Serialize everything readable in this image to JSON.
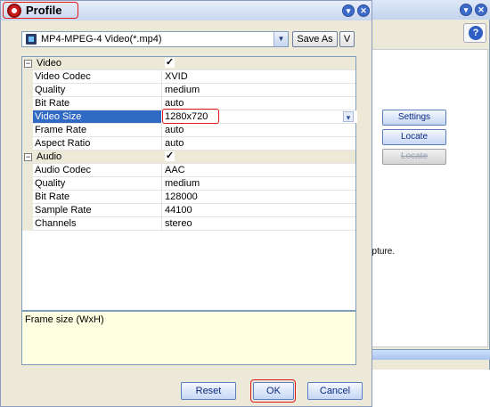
{
  "dialog": {
    "title": "Profile",
    "minimize_glyph": "▾",
    "close_glyph": "✕"
  },
  "format": {
    "selected": "MP4-MPEG-4 Video(*.mp4)",
    "dropdown_glyph": "▼",
    "icon": "film-icon",
    "save_as_label": "Save As",
    "v_label": "V"
  },
  "grid": {
    "video": {
      "category": "Video",
      "expander": "−",
      "enabled_glyph": "✓",
      "rows": [
        {
          "name": "Video Codec",
          "value": "XVID"
        },
        {
          "name": "Quality",
          "value": "medium"
        },
        {
          "name": "Bit Rate",
          "value": "auto"
        },
        {
          "name": "Video Size",
          "value": "1280x720"
        },
        {
          "name": "Frame Rate",
          "value": "auto"
        },
        {
          "name": "Aspect Ratio",
          "value": "auto"
        }
      ]
    },
    "audio": {
      "category": "Audio",
      "expander": "−",
      "enabled_glyph": "✓",
      "rows": [
        {
          "name": "Audio Codec",
          "value": "AAC"
        },
        {
          "name": "Quality",
          "value": "medium"
        },
        {
          "name": "Bit Rate",
          "value": "128000"
        },
        {
          "name": "Sample Rate",
          "value": "44100"
        },
        {
          "name": "Channels",
          "value": "stereo"
        }
      ]
    },
    "dropdown_glyph": "▾"
  },
  "description": "Frame size (WxH)",
  "buttons": {
    "reset": "Reset",
    "ok": "OK",
    "cancel": "Cancel"
  },
  "background_window": {
    "help_glyph": "?",
    "settings_label": "Settings",
    "locate_label": "Locate",
    "locate_disabled_label": "Locate",
    "capture_text": "apture.",
    "minimize_glyph": "▾",
    "close_glyph": "✕"
  },
  "colors": {
    "selection": "#316ac5",
    "highlight_outline": "#e01a1a",
    "description_bg": "#ffffe1"
  }
}
